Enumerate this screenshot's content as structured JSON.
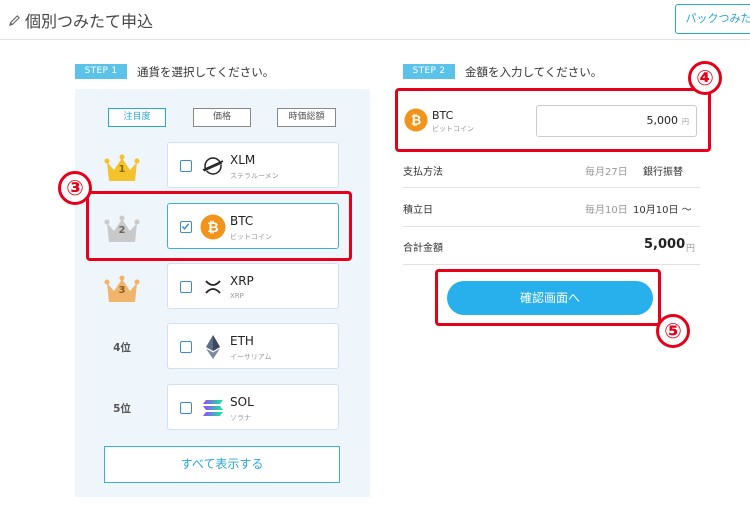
{
  "header": {
    "title": "個別つみたて申込",
    "pack_button_label": "パックつみたて"
  },
  "step1": {
    "badge": "STEP 1",
    "instruction": "通貨を選択してください。",
    "sort_tabs": [
      {
        "label": "注目度",
        "active": true
      },
      {
        "label": "価格",
        "active": false
      },
      {
        "label": "時価総額",
        "active": false
      }
    ],
    "ranks": [
      "1",
      "2",
      "3",
      "4位",
      "5位"
    ],
    "coins": [
      {
        "symbol": "XLM",
        "name": "ステラルーメン",
        "checked": false,
        "icon": "stellar-icon"
      },
      {
        "symbol": "BTC",
        "name": "ビットコイン",
        "checked": true,
        "icon": "bitcoin-icon"
      },
      {
        "symbol": "XRP",
        "name": "XRP",
        "checked": false,
        "icon": "xrp-icon"
      },
      {
        "symbol": "ETH",
        "name": "イーサリアム",
        "checked": false,
        "icon": "ethereum-icon"
      },
      {
        "symbol": "SOL",
        "name": "ソラナ",
        "checked": false,
        "icon": "solana-icon"
      }
    ],
    "show_all_label": "すべて表示する"
  },
  "step2": {
    "badge": "STEP 2",
    "instruction": "金額を入力してください。",
    "selected_coin": {
      "symbol": "BTC",
      "name": "ビットコイン"
    },
    "amount_value": "5,000",
    "amount_unit": "円",
    "rows": [
      {
        "label": "支払方法",
        "sub": "毎月27日",
        "value": "銀行振替"
      },
      {
        "label": "積立日",
        "sub": "毎月10日",
        "value": "10月10日 〜"
      }
    ],
    "total": {
      "label": "合計金額",
      "value": "5,000",
      "unit": "円"
    },
    "confirm_label": "確認画面へ"
  },
  "callouts": [
    "③",
    "④",
    "⑤"
  ],
  "colors": {
    "accent": "#27b0ec",
    "step_badge": "#5bc3ea",
    "highlight": "#e6001a",
    "gold": "#f4c22b",
    "silver": "#c9c9c9",
    "bronze": "#f0b46a",
    "bitcoin": "#f2931b"
  }
}
